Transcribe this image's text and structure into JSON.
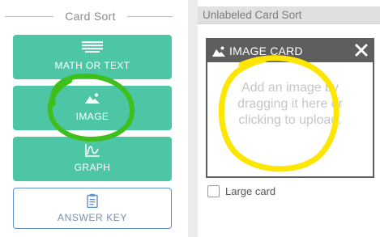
{
  "left_panel": {
    "heading": "Card Sort",
    "buttons": {
      "math_or_text": "MATH OR TEXT",
      "image": "IMAGE",
      "graph": "GRAPH",
      "answer_key": "ANSWER KEY"
    }
  },
  "right_panel": {
    "title": "Unlabeled Card Sort",
    "image_card": {
      "title": "IMAGE CARD",
      "placeholder": "Add an image by dragging it here or clicking to upload."
    },
    "large_card_label": "Large card",
    "large_card_checked": false
  },
  "icons": [
    "text-icon",
    "image-icon",
    "graph-icon",
    "clipboard-icon",
    "close-icon"
  ],
  "colors": {
    "button_teal": "#4cc6a5",
    "answer_key_border": "#5f8fcf",
    "card_header": "#5e5e5e",
    "highlight_green": "#3fbf1c",
    "highlight_yellow": "#ffe600"
  }
}
